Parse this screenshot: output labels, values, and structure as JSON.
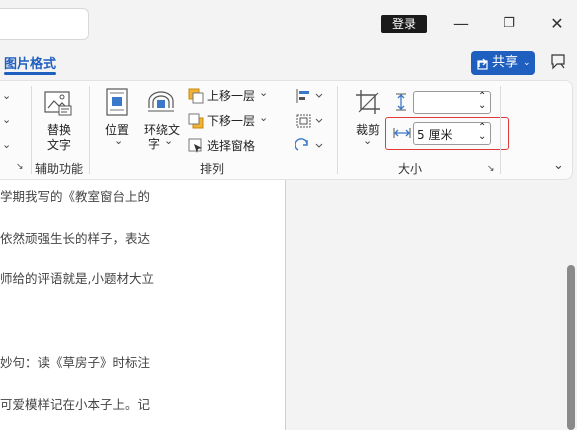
{
  "titlebar": {
    "login_label": "登录",
    "minimize_glyph": "—",
    "restore_glyph": "❐",
    "close_glyph": "✕"
  },
  "tabs": {
    "active_label": "图片格式"
  },
  "share": {
    "label": "共享",
    "caret": "⌄"
  },
  "ribbon": {
    "left_partial_chevrons": [
      "⌄",
      "⌄"
    ],
    "alt_text": {
      "label_line1": "替换",
      "label_line2": "文字",
      "group_label": "辅助功能"
    },
    "arrange": {
      "position_label": "位置",
      "wrap_label_line1": "环绕文",
      "wrap_label_line2": "字",
      "bring_forward": "上移一层",
      "send_backward": "下移一层",
      "selection_pane": "选择窗格",
      "group_label": "排列",
      "caret": "⌄"
    },
    "size": {
      "crop_label": "裁剪",
      "height_value": "",
      "width_value": "5 厘米",
      "group_label": "大小",
      "spinner_up": "⌃",
      "spinner_down": "⌄"
    },
    "collapse_glyph": "⌄",
    "dialog_launcher": "↘"
  },
  "document": {
    "lines": [
      "学期我写的《教室窗台上的",
      "依然顽强生长的样子，表达",
      "师给的评语就是,小题材大立",
      "",
      "妙句：读《草房子》时标注",
      "可爱模样记在小本子上。记"
    ]
  },
  "colors": {
    "accent": "#1f5fbf",
    "highlight": "#e03a3a"
  }
}
